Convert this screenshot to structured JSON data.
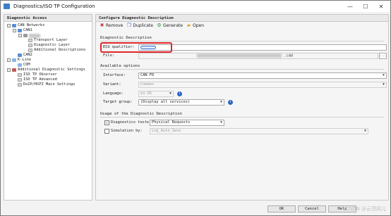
{
  "window": {
    "title": "Diagnostics/ISO TP Configuration",
    "controls": [
      "—",
      "☐",
      "✕"
    ]
  },
  "left_panel": {
    "header": "Diagnostic Access",
    "tree": [
      {
        "label": "CAN Networks",
        "expander": "-",
        "icon": "network-icon"
      },
      {
        "label": "CAN1",
        "expander": "-",
        "icon": "network-icon"
      },
      {
        "label": "",
        "expander": "-",
        "icon": "ecu-icon"
      },
      {
        "label": "Transport Layer",
        "expander": "",
        "icon": "document-icon"
      },
      {
        "label": "Diagnostic Layer",
        "expander": "",
        "icon": "document-icon"
      },
      {
        "label": "Additional Descriptions",
        "expander": "",
        "icon": "document-icon"
      },
      {
        "label": "CAN2",
        "expander": "",
        "icon": "network-icon"
      },
      {
        "label": "K-Line",
        "expander": "-",
        "icon": "kline-icon"
      },
      {
        "label": "COM",
        "expander": "",
        "icon": "kline-icon"
      },
      {
        "label": "Additional Diagnostic Settings",
        "expander": "-",
        "icon": "settings-icon"
      },
      {
        "label": "ISO TP Observer",
        "expander": "",
        "icon": "document-icon"
      },
      {
        "label": "ISO TP Advanced",
        "expander": "",
        "icon": "document-icon"
      },
      {
        "label": "DoIP/HSFZ Main Settings",
        "expander": "",
        "icon": "document-icon"
      }
    ]
  },
  "right_panel": {
    "header": "Configure Diagnostic Description",
    "toolbar": {
      "remove": "Remove",
      "duplicate": "Duplicate",
      "generate": "Generate",
      "open": "Open"
    },
    "diag_desc": {
      "title": "Diagnostic Description",
      "ecu_qualifier_label": "ECU qualifier:",
      "file_label": "File:",
      "file_value": ".cdd",
      "browse": "..."
    },
    "available": {
      "title": "Available options",
      "interface_label": "Interface:",
      "interface_value": "CAN FD",
      "variant_label": "Variant:",
      "variant_value": "Common",
      "language_label": "Language:",
      "language_value": "en-US",
      "target_label": "Target group:",
      "target_value": "(Display all services)"
    },
    "usage": {
      "title": "Usage of the Diagnostic Description",
      "tester_label": "Diagnostics tester",
      "tester_checked": true,
      "tester_value": "Physical Requests",
      "sim_label": "Simulation by:",
      "sim_checked": false,
      "sim_value": "Log_Auto_Save"
    }
  },
  "buttons": {
    "ok": "OK",
    "cancel": "Cancel",
    "help": "Help"
  },
  "watermark": "CSDN @云顶风儿"
}
